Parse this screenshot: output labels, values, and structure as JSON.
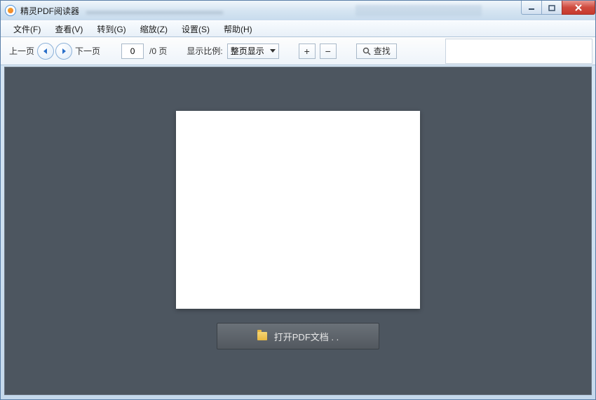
{
  "title": "精灵PDF阅读器",
  "menus": {
    "file": "文件(F)",
    "view": "查看(V)",
    "goto": "转到(G)",
    "zoom": "缩放(Z)",
    "settings": "设置(S)",
    "help": "帮助(H)"
  },
  "toolbar": {
    "prev": "上一页",
    "next": "下一页",
    "page_value": "0",
    "page_total": "/0 页",
    "zoom_label": "显示比例:",
    "zoom_value": "整页显示",
    "plus": "+",
    "minus": "−",
    "search": "查找"
  },
  "main": {
    "open_pdf": "打开PDF文档 . ."
  }
}
